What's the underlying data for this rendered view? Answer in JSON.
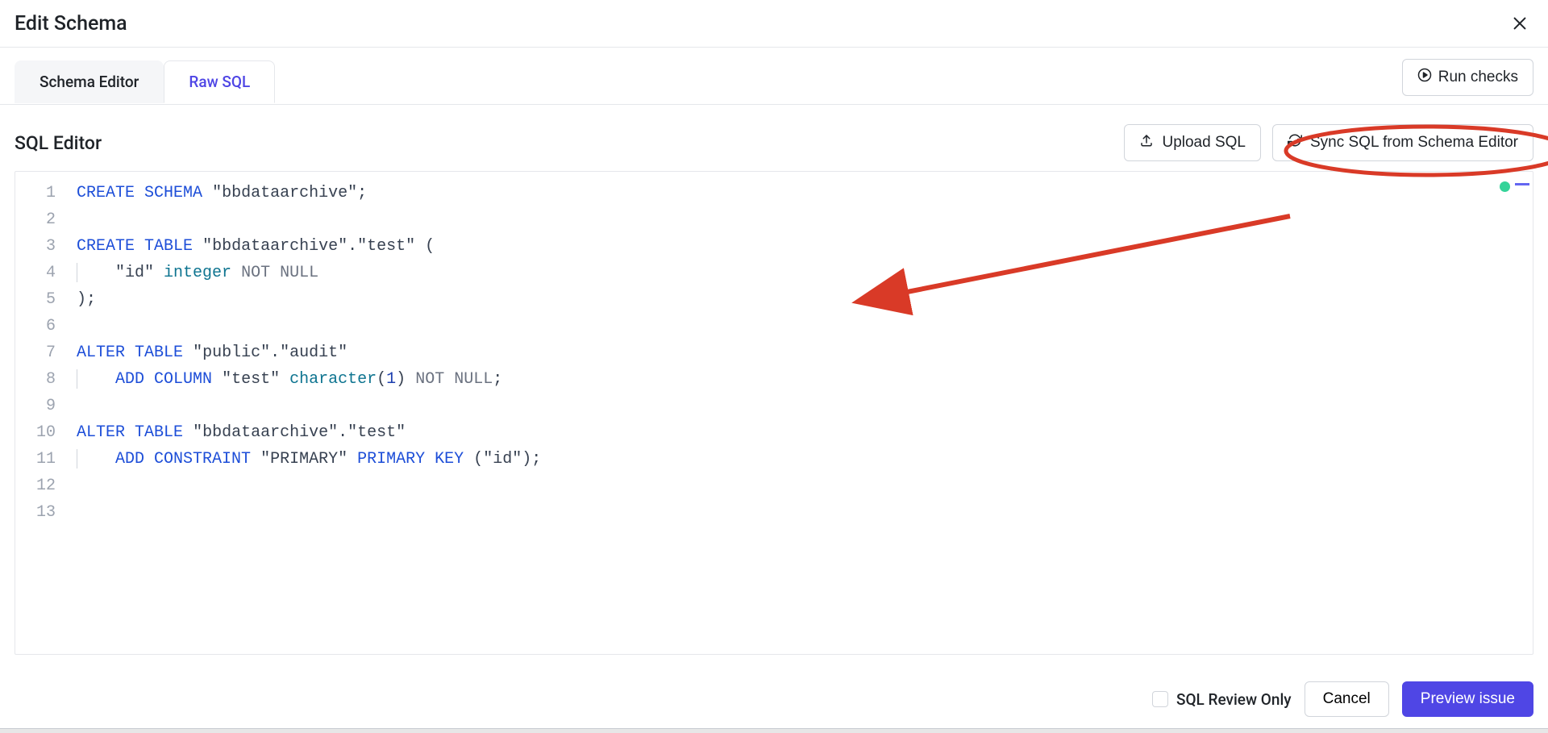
{
  "header": {
    "title": "Edit Schema",
    "close_tooltip": "Close"
  },
  "tabs": {
    "schema_editor": "Schema Editor",
    "raw_sql": "Raw SQL"
  },
  "run_checks_label": "Run checks",
  "section_title": "SQL Editor",
  "actions": {
    "upload_sql": "Upload SQL",
    "sync_sql": "Sync SQL from Schema Editor"
  },
  "code": {
    "lines": [
      {
        "n": 1,
        "tokens": [
          {
            "t": "CREATE",
            "c": "kw"
          },
          {
            "t": " "
          },
          {
            "t": "SCHEMA",
            "c": "kw"
          },
          {
            "t": " "
          },
          {
            "t": "\"bbdataarchive\"",
            "c": "str"
          },
          {
            "t": ";",
            "c": "punc"
          }
        ]
      },
      {
        "n": 2,
        "tokens": []
      },
      {
        "n": 3,
        "tokens": [
          {
            "t": "CREATE",
            "c": "kw"
          },
          {
            "t": " "
          },
          {
            "t": "TABLE",
            "c": "kw"
          },
          {
            "t": " "
          },
          {
            "t": "\"bbdataarchive\"",
            "c": "str"
          },
          {
            "t": ".",
            "c": "punc"
          },
          {
            "t": "\"test\"",
            "c": "str"
          },
          {
            "t": " (",
            "c": "punc"
          }
        ]
      },
      {
        "n": 4,
        "indent": 2,
        "guide": true,
        "tokens": [
          {
            "t": "\"id\"",
            "c": "str"
          },
          {
            "t": " "
          },
          {
            "t": "integer",
            "c": "ty"
          },
          {
            "t": " "
          },
          {
            "t": "NOT",
            "c": "mod"
          },
          {
            "t": " "
          },
          {
            "t": "NULL",
            "c": "mod"
          }
        ]
      },
      {
        "n": 5,
        "tokens": [
          {
            "t": ");",
            "c": "punc"
          }
        ]
      },
      {
        "n": 6,
        "tokens": []
      },
      {
        "n": 7,
        "tokens": [
          {
            "t": "ALTER",
            "c": "kw"
          },
          {
            "t": " "
          },
          {
            "t": "TABLE",
            "c": "kw"
          },
          {
            "t": " "
          },
          {
            "t": "\"public\"",
            "c": "str"
          },
          {
            "t": ".",
            "c": "punc"
          },
          {
            "t": "\"audit\"",
            "c": "str"
          }
        ]
      },
      {
        "n": 8,
        "indent": 2,
        "guide": true,
        "tokens": [
          {
            "t": "ADD",
            "c": "kw"
          },
          {
            "t": " "
          },
          {
            "t": "COLUMN",
            "c": "kw"
          },
          {
            "t": " "
          },
          {
            "t": "\"test\"",
            "c": "str"
          },
          {
            "t": " "
          },
          {
            "t": "character",
            "c": "ty"
          },
          {
            "t": "(",
            "c": "punc"
          },
          {
            "t": "1",
            "c": "num"
          },
          {
            "t": ")",
            "c": "punc"
          },
          {
            "t": " "
          },
          {
            "t": "NOT",
            "c": "mod"
          },
          {
            "t": " "
          },
          {
            "t": "NULL",
            "c": "mod"
          },
          {
            "t": ";",
            "c": "punc"
          }
        ]
      },
      {
        "n": 9,
        "tokens": []
      },
      {
        "n": 10,
        "tokens": [
          {
            "t": "ALTER",
            "c": "kw"
          },
          {
            "t": " "
          },
          {
            "t": "TABLE",
            "c": "kw"
          },
          {
            "t": " "
          },
          {
            "t": "\"bbdataarchive\"",
            "c": "str"
          },
          {
            "t": ".",
            "c": "punc"
          },
          {
            "t": "\"test\"",
            "c": "str"
          }
        ]
      },
      {
        "n": 11,
        "indent": 2,
        "guide": true,
        "tokens": [
          {
            "t": "ADD",
            "c": "kw"
          },
          {
            "t": " "
          },
          {
            "t": "CONSTRAINT",
            "c": "kw"
          },
          {
            "t": " "
          },
          {
            "t": "\"PRIMARY\"",
            "c": "str"
          },
          {
            "t": " "
          },
          {
            "t": "PRIMARY",
            "c": "kw"
          },
          {
            "t": " "
          },
          {
            "t": "KEY",
            "c": "kw"
          },
          {
            "t": " (",
            "c": "punc"
          },
          {
            "t": "\"id\"",
            "c": "str"
          },
          {
            "t": ");",
            "c": "punc"
          }
        ]
      },
      {
        "n": 12,
        "tokens": []
      },
      {
        "n": 13,
        "tokens": []
      }
    ]
  },
  "footer": {
    "sql_review_only": "SQL Review Only",
    "cancel": "Cancel",
    "preview_issue": "Preview issue"
  },
  "colors": {
    "accent": "#4f46e5",
    "annotation": "#d93a27"
  }
}
